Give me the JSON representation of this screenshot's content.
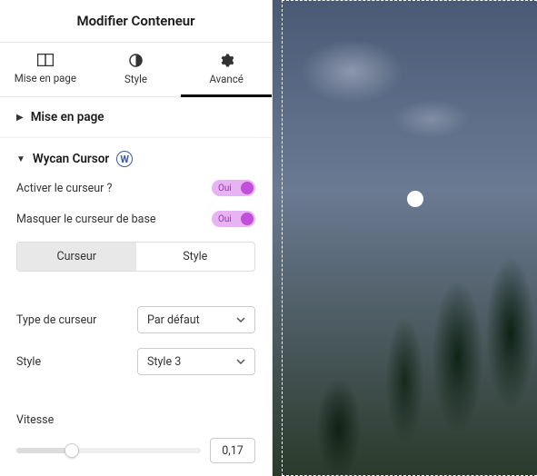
{
  "panel": {
    "title": "Modifier Conteneur"
  },
  "tabs": {
    "layout": "Mise en page",
    "style": "Style",
    "advanced": "Avancé"
  },
  "sections": {
    "layout": {
      "title": "Mise en page"
    },
    "wycan": {
      "title": "Wycan Cursor",
      "fields": {
        "activate_label": "Activer le curseur ?",
        "activate_value": "Oui",
        "hide_base_label": "Masquer le curseur de base",
        "hide_base_value": "Oui",
        "segment_cursor": "Curseur",
        "segment_style": "Style",
        "type_label": "Type de curseur",
        "type_value": "Par défaut",
        "style_label": "Style",
        "style_value": "Style 3",
        "speed_label": "Vitesse",
        "speed_value": "0,17"
      }
    }
  }
}
